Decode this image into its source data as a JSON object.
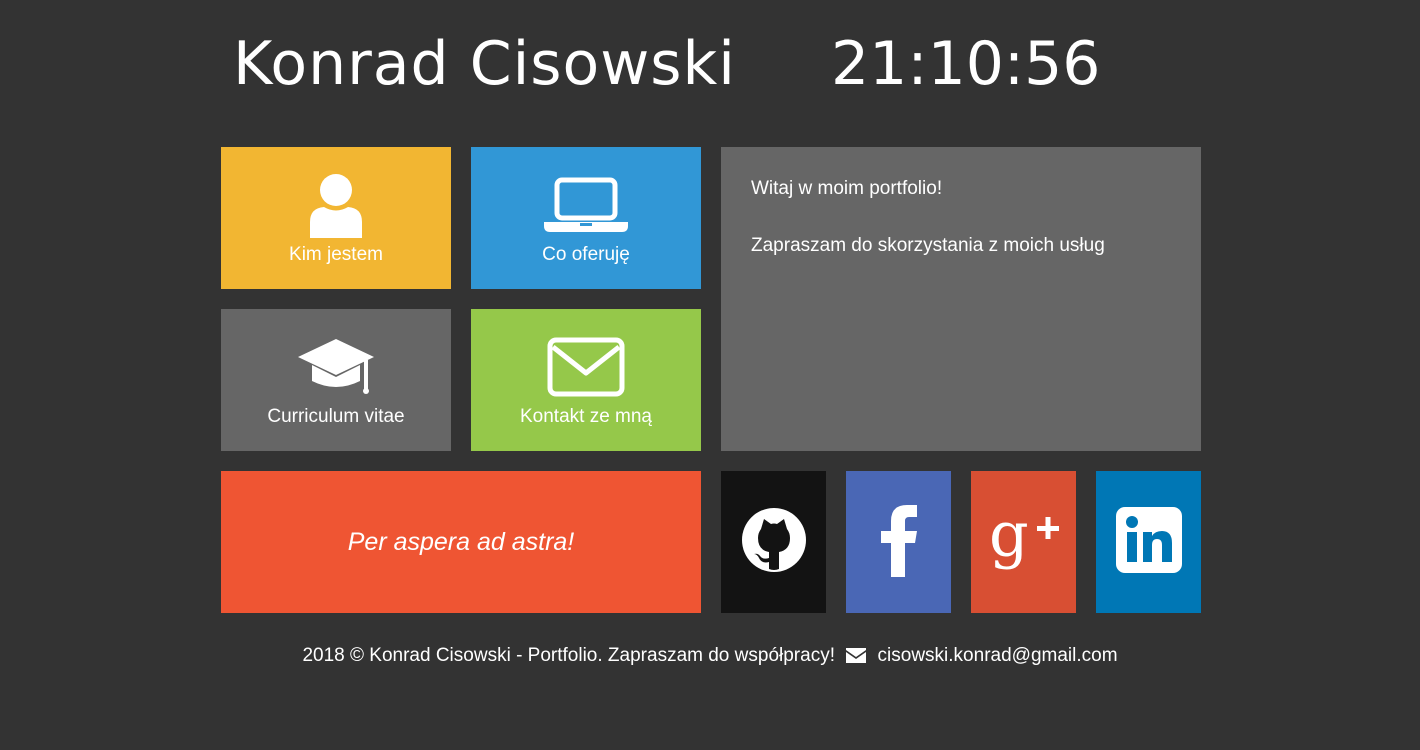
{
  "header": {
    "name": "Konrad Cisowski",
    "clock": "21:10:56"
  },
  "nav": {
    "about": {
      "label": "Kim jestem",
      "icon": "user-icon",
      "color": "#f2b632"
    },
    "offer": {
      "label": "Co oferuję",
      "icon": "laptop-icon",
      "color": "#3197d6"
    },
    "cv": {
      "label": "Curriculum vitae",
      "icon": "graduation-cap-icon",
      "color": "#666666"
    },
    "contact": {
      "label": "Kontakt ze mną",
      "icon": "envelope-icon",
      "color": "#95c84a"
    }
  },
  "content": {
    "line1": "Witaj w moim portfolio!",
    "line2": "Zapraszam do skorzystania z moich usług"
  },
  "motto": {
    "text": "Per aspera ad astra!",
    "color": "#ef5533"
  },
  "social": [
    {
      "name": "github",
      "icon": "github-icon",
      "color": "#131313"
    },
    {
      "name": "facebook",
      "icon": "facebook-icon",
      "color": "#4a67b5"
    },
    {
      "name": "google-plus",
      "icon": "google-plus-icon",
      "color": "#d84f33"
    },
    {
      "name": "linkedin",
      "icon": "linkedin-icon",
      "color": "#0077b5"
    }
  ],
  "footer": {
    "text": "2018 © Konrad Cisowski - Portfolio. Zapraszam do współpracy!",
    "email": "cisowski.konrad@gmail.com"
  },
  "colors": {
    "background": "#333333",
    "panel": "#666666"
  }
}
